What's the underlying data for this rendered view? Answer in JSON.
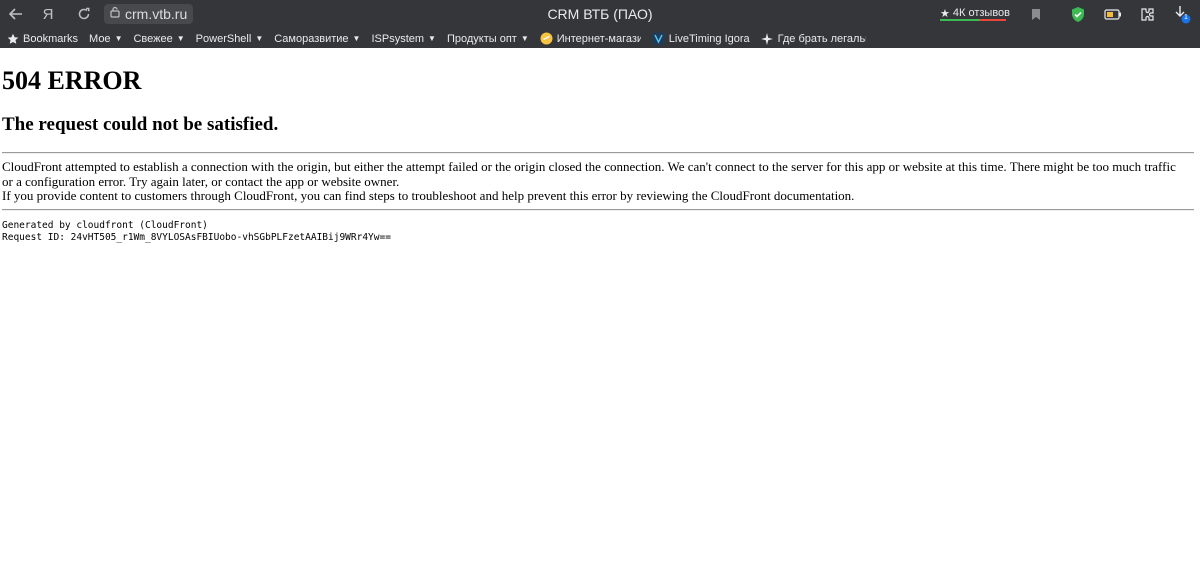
{
  "browser": {
    "url": "crm.vtb.ru",
    "page_title": "CRM ВТБ (ПАО)",
    "reviews_label": "4К отзывов",
    "nav": {
      "back_icon": "back-arrow-icon",
      "yandex_icon": "yandex-logo-icon",
      "reload_icon": "reload-icon"
    },
    "toolbar_icons": [
      "bookmark-icon",
      "shield-icon",
      "battery-icon",
      "extensions-icon",
      "download-icon"
    ],
    "download_badge": "1",
    "bookmarks": [
      {
        "label": "Bookmarks",
        "icon": "star-icon",
        "menu": false
      },
      {
        "label": "Мое",
        "menu": true
      },
      {
        "label": "Свежее",
        "menu": true
      },
      {
        "label": "PowerShell",
        "menu": true
      },
      {
        "label": "Саморазвитие",
        "menu": true
      },
      {
        "label": "ISPsystem",
        "menu": true
      },
      {
        "label": "Продукты опт",
        "menu": true
      },
      {
        "label": "Интернет-магазин",
        "icon": "shop-icon",
        "menu": false
      },
      {
        "label": "LiveTiming Igora",
        "icon": "livetiming-icon",
        "menu": false
      },
      {
        "label": "Где брать легальн",
        "icon": "sparkle-icon",
        "menu": false
      }
    ],
    "colors": {
      "chrome_bg": "#35363a",
      "shield_green": "#3cba54"
    }
  },
  "page": {
    "heading": "504 ERROR",
    "subheading": "The request could not be satisfied.",
    "paragraph1": "CloudFront attempted to establish a connection with the origin, but either the attempt failed or the origin closed the connection. We can't connect to the server for this app or website at this time. There might be too much traffic or a configuration error. Try again later, or contact the app or website owner.",
    "paragraph2": "If you provide content to customers through CloudFront, you can find steps to troubleshoot and help prevent this error by reviewing the CloudFront documentation.",
    "generated_by": "Generated by cloudfront (CloudFront)",
    "request_id": "Request ID: 24vHT505_r1Wm_8VYLOSAsFBIUobo-vhSGbPLFzetAAIBij9WRr4Yw=="
  }
}
